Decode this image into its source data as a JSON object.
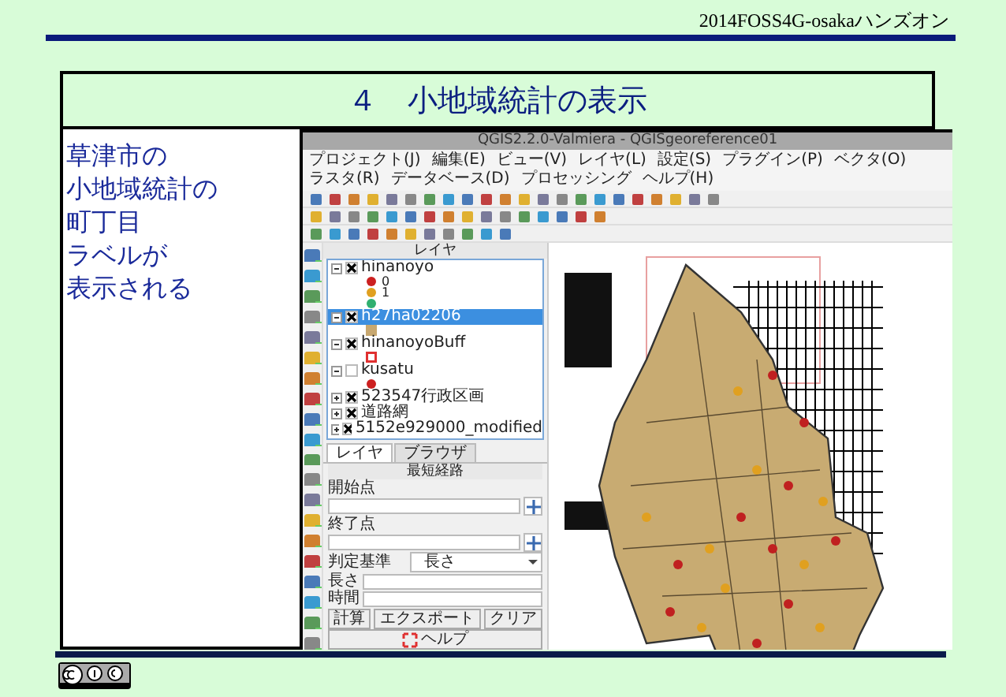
{
  "header": {
    "text": "2014FOSS4G-osakaハンズオン"
  },
  "title": "４　小地域統計の表示",
  "note_lines": [
    "草津市の",
    "小地域統計の",
    "町丁目",
    "ラベルが",
    "表示される"
  ],
  "qgis": {
    "window_title": "QGIS2.2.0-Valmiera - QGISgeoreference01",
    "menu": [
      "プロジェクト(J)",
      "編集(E)",
      "ビュー(V)",
      "レイヤ(L)",
      "設定(S)",
      "プラグイン(P)",
      "ベクタ(O)",
      "ラスタ(R)",
      "データベース(D)",
      "プロセッシング",
      "ヘルプ(H)"
    ],
    "layers_panel": {
      "title": "レイヤ",
      "layers": [
        {
          "name": "hinanoyo",
          "checked": true,
          "selected": false,
          "expanded": true,
          "symbols": [
            {
              "kind": "dot",
              "color": "#cc2020",
              "label": "0"
            },
            {
              "kind": "dot",
              "color": "#e0a020",
              "label": "1"
            },
            {
              "kind": "dot",
              "color": "#30b070"
            }
          ]
        },
        {
          "name": "h27ha02206",
          "checked": true,
          "selected": true,
          "expanded": true,
          "symbols": [
            {
              "kind": "square",
              "color": "#c8a870"
            }
          ]
        },
        {
          "name": "hinanoyoBuff",
          "checked": true,
          "selected": false,
          "expanded": true,
          "symbols": [
            {
              "kind": "outline",
              "color": "#e03030"
            }
          ]
        },
        {
          "name": "kusatu",
          "checked": false,
          "selected": false,
          "expanded": true,
          "symbols": [
            {
              "kind": "dot",
              "color": "#cc2020"
            }
          ]
        },
        {
          "name": "523547行政区画",
          "checked": true,
          "selected": false,
          "expanded": false
        },
        {
          "name": "道路網",
          "checked": true,
          "selected": false,
          "expanded": false
        },
        {
          "name": "5152e929000_modified",
          "checked": true,
          "selected": false,
          "expanded": false
        }
      ]
    },
    "tabs": [
      {
        "label": "レイヤ",
        "selected": true
      },
      {
        "label": "ブラウザ",
        "selected": false
      }
    ],
    "route_panel": {
      "title": "最短経路",
      "start_label": "開始点",
      "end_label": "終了点",
      "criterion_label": "判定基準",
      "criterion_value": "長さ",
      "length_label": "長さ",
      "time_label": "時間",
      "buttons": [
        "計算",
        "エクスポート",
        "クリア"
      ],
      "help": "ヘルプ"
    }
  }
}
